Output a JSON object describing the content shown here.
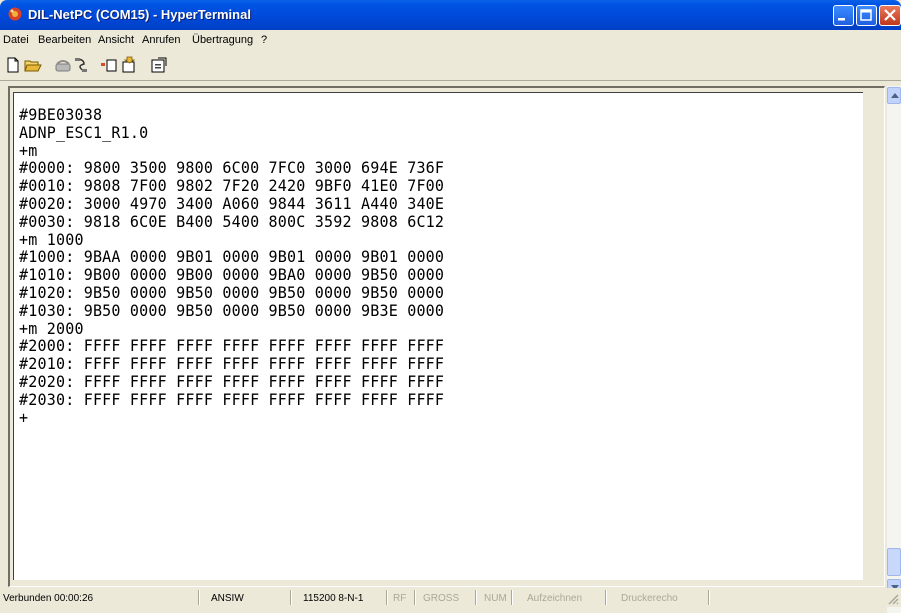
{
  "window": {
    "title": "DIL-NetPC (COM15) - HyperTerminal"
  },
  "menu": [
    {
      "label": "Datei"
    },
    {
      "label": "Bearbeiten"
    },
    {
      "label": "Ansicht"
    },
    {
      "label": "Anrufen"
    },
    {
      "label": "Übertragung"
    },
    {
      "label": "?"
    }
  ],
  "toolbar": {
    "icons": [
      "new-icon",
      "open-icon",
      "call-icon",
      "disconnect-icon",
      "send-icon",
      "receive-icon",
      "properties-icon"
    ]
  },
  "terminal": {
    "lines": [
      "#9BE03038",
      "ADNP_ESC1_R1.0",
      "+m",
      "#0000: 9800 3500 9800 6C00 7FC0 3000 694E 736F",
      "#0010: 9808 7F00 9802 7F20 2420 9BF0 41E0 7F00",
      "#0020: 3000 4970 3400 A060 9844 3611 A440 340E",
      "#0030: 9818 6C0E B400 5400 800C 3592 9808 6C12",
      "+m 1000",
      "#1000: 9BAA 0000 9B01 0000 9B01 0000 9B01 0000",
      "#1010: 9B00 0000 9B00 0000 9BA0 0000 9B50 0000",
      "#1020: 9B50 0000 9B50 0000 9B50 0000 9B50 0000",
      "#1030: 9B50 0000 9B50 0000 9B50 0000 9B3E 0000",
      "+m 2000",
      "#2000: FFFF FFFF FFFF FFFF FFFF FFFF FFFF FFFF",
      "#2010: FFFF FFFF FFFF FFFF FFFF FFFF FFFF FFFF",
      "#2020: FFFF FFFF FFFF FFFF FFFF FFFF FFFF FFFF",
      "#2030: FFFF FFFF FFFF FFFF FFFF FFFF FFFF FFFF",
      "+"
    ]
  },
  "status": {
    "connected": "Verbunden 00:00:26",
    "emulation": "ANSIW",
    "settings": "115200 8-N-1",
    "rf": "RF",
    "gross": "GROSS",
    "num": "NUM",
    "aufzeichnen": "Aufzeichnen",
    "druckerecho": "Druckerecho"
  },
  "colors": {
    "title_bar": "#0054e3",
    "terminal_bg": "#ffffff",
    "terminal_text": "#000000"
  }
}
